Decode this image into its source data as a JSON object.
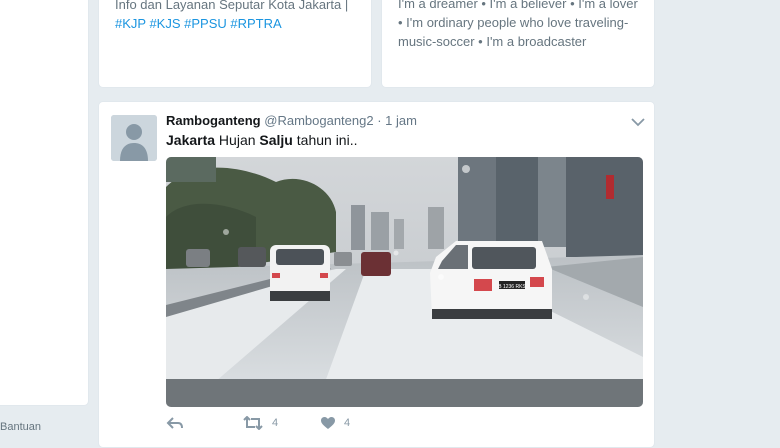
{
  "left_column": {
    "footer_link": "Bantuan"
  },
  "profile_cards": [
    {
      "bio_line1": "Info dan Layanan Seputar Kota Jakarta |",
      "bio_hashtags": "#KJP #KJS #PPSU #RPTRA"
    },
    {
      "bio_line1": "I'm a dreamer • I'm a believer • I'm a lover",
      "bio_line2": "• I'm ordinary people who love traveling-",
      "bio_line3": "music-soccer • I'm a broadcaster"
    }
  ],
  "tweet": {
    "display_name": "Ramboganteng",
    "handle": "@Ramboganteng2",
    "separator": " · ",
    "time": "1 jam",
    "text_word1": "Jakarta",
    "text_word2": " Hujan ",
    "text_word3": "Salju",
    "text_word4": " tahun ini..",
    "reply_icon": "reply-icon",
    "retweet_icon": "retweet-icon",
    "like_icon": "heart-icon",
    "retweet_count": "4",
    "like_count": "4",
    "plate_text": "B 1236 RKS",
    "colors": {
      "link": "#1b95e0",
      "muted": "#657786",
      "border": "#e1e8ed",
      "background": "#e6ecf0"
    }
  }
}
